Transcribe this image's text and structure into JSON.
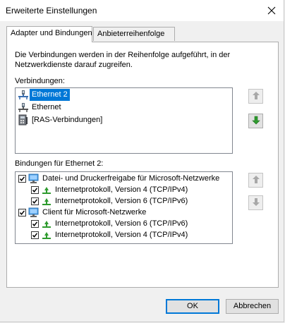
{
  "window": {
    "title": "Erweiterte Einstellungen"
  },
  "tabs": [
    {
      "label": "Adapter und Bindungen",
      "active": true
    },
    {
      "label": "Anbieterreihenfolge",
      "active": false
    }
  ],
  "panel": {
    "description": "Die Verbindungen werden in der Reihenfolge aufgeführt, in der Netzwerkdienste darauf zugreifen.",
    "connections_label": "Verbindungen:",
    "connections": [
      {
        "label": "Ethernet 2",
        "icon": "network-adapter-icon",
        "selected": true
      },
      {
        "label": "Ethernet",
        "icon": "network-adapter-icon",
        "selected": false
      },
      {
        "label": "[RAS-Verbindungen]",
        "icon": "ras-phone-icon",
        "selected": false
      }
    ],
    "bindings_label": "Bindungen für Ethernet 2:",
    "bindings": [
      {
        "label": "Datei- und Druckerfreigabe für Microsoft-Netzwerke",
        "level": 0,
        "checked": true,
        "icon": "network-service-icon"
      },
      {
        "label": "Internetprotokoll, Version 4 (TCP/IPv4)",
        "level": 1,
        "checked": true,
        "icon": "protocol-icon"
      },
      {
        "label": "Internetprotokoll, Version 6 (TCP/IPv6)",
        "level": 1,
        "checked": true,
        "icon": "protocol-icon"
      },
      {
        "label": "Client für Microsoft-Netzwerke",
        "level": 0,
        "checked": true,
        "icon": "network-client-icon"
      },
      {
        "label": "Internetprotokoll, Version 6 (TCP/IPv6)",
        "level": 1,
        "checked": true,
        "icon": "protocol-icon"
      },
      {
        "label": "Internetprotokoll, Version 4 (TCP/IPv4)",
        "level": 1,
        "checked": true,
        "icon": "protocol-icon"
      }
    ]
  },
  "buttons": {
    "ok": "OK",
    "cancel": "Abbrechen"
  },
  "colors": {
    "selection": "#0078d7",
    "arrow_enabled": "#2e9b2e",
    "arrow_disabled": "#a0a0a0"
  }
}
